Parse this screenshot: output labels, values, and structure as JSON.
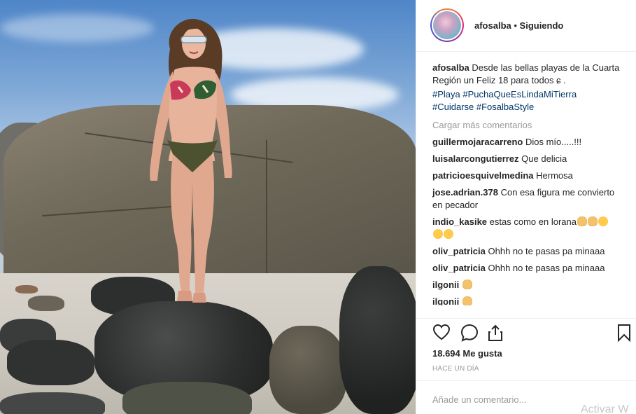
{
  "post": {
    "username": "afosalba",
    "separator": " • ",
    "follow_status": "Siguiendo"
  },
  "caption": {
    "username": "afosalba",
    "text": "Desde las bellas playas de la Cuarta Región un Feliz 18 para todos ɕ .",
    "hashtags": [
      "#Playa",
      "#PuchaQueEsLindaMiTierra",
      "#Cuidarse",
      "#FosalbaStyle"
    ]
  },
  "load_more": "Cargar más comentarios",
  "comments": [
    {
      "user": "guillermojaracarreno",
      "text": "Dios mío.....!!!"
    },
    {
      "user": "luisalarcongutierrez",
      "text": "Que delicia"
    },
    {
      "user": "patricioesquivelmedina",
      "text": "Hermosa"
    },
    {
      "user": "jose.adrian.378",
      "text": "Con esa figura me convierto en pecador"
    },
    {
      "user": "indio_kasike",
      "text": "estas como en lorana",
      "emojis": [
        "clap-emoji",
        "clap-emoji",
        "heart-eyes-emoji",
        "heart-eyes-emoji",
        "heart-eyes-emoji"
      ]
    },
    {
      "user": "oliv_patricia",
      "text": "Ohhh no te pasas pa minaaa"
    },
    {
      "user": "oliv_patricia",
      "text": "Ohhh no te pasas pa minaaa"
    },
    {
      "user": "ilgonii",
      "text": "",
      "emojis": [
        "clap-emoji"
      ]
    },
    {
      "user": "ilgonii",
      "text": "",
      "emojis": [
        "clap-emoji"
      ]
    }
  ],
  "actions": {
    "icons": [
      "heart-icon",
      "comment-icon",
      "share-icon",
      "bookmark-icon"
    ]
  },
  "likes": "18.694 Me gusta",
  "timestamp": "HACE UN DÍA",
  "add_comment_placeholder": "Añade un comentario...",
  "watermark": "Activar W",
  "colors": {
    "text": "#262626",
    "muted": "#999999",
    "hashtag": "#003569",
    "border": "#efefef"
  }
}
